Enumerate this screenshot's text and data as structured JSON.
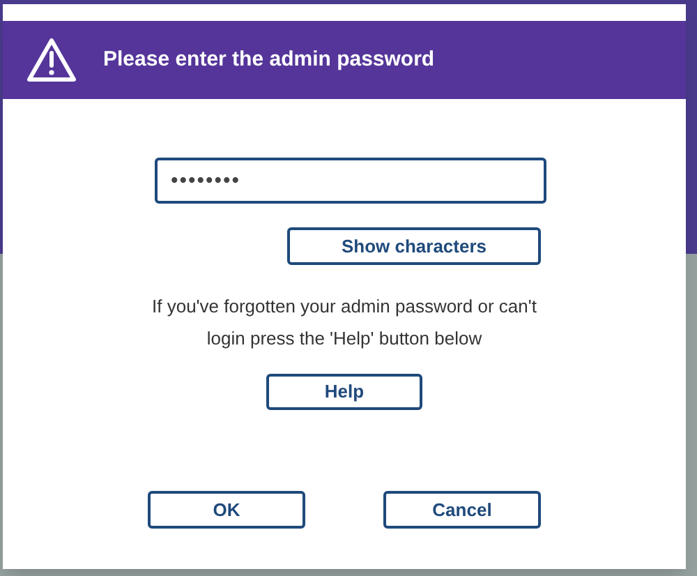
{
  "dialog": {
    "title": "Please enter the admin password",
    "password_field": {
      "value": "••••••••"
    },
    "show_button": "Show characters",
    "help_text": "If you've forgotten your admin password or can't login press the 'Help' button below",
    "help_button": "Help",
    "buttons": [
      {
        "label": "OK"
      },
      {
        "label": "Cancel"
      }
    ]
  }
}
